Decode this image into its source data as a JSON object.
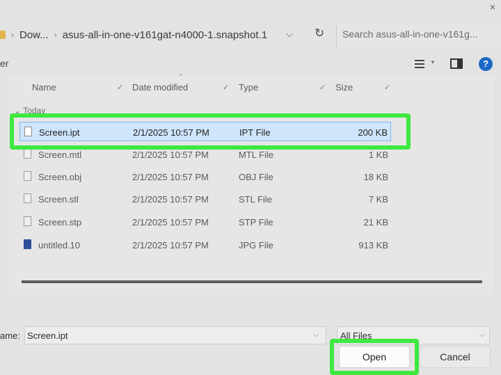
{
  "window": {
    "close_glyph": "×"
  },
  "address": {
    "crumbs": [
      "Dow...",
      "asus-all-in-one-v161gat-n4000-1.snapshot.1"
    ],
    "separator": "›",
    "dropdown_glyph": "⌵",
    "refresh_glyph": "↻"
  },
  "search": {
    "placeholder": "Search asus-all-in-one-v161g..."
  },
  "toolbar": {
    "left_label": "er",
    "help_glyph": "?"
  },
  "columns": {
    "name": "Name",
    "date": "Date modified",
    "type": "Type",
    "size": "Size",
    "chevron": "✓",
    "sort_caret": "⌃"
  },
  "group": {
    "label": "⌄ Today"
  },
  "files": [
    {
      "name": "Screen.ipt",
      "date": "2/1/2025 10:57 PM",
      "type": "IPT File",
      "size": "200 KB",
      "selected": true,
      "icon": "document-icon"
    },
    {
      "name": "Screen.mtl",
      "date": "2/1/2025 10:57 PM",
      "type": "MTL File",
      "size": "1 KB",
      "icon": "document-icon"
    },
    {
      "name": "Screen.obj",
      "date": "2/1/2025 10:57 PM",
      "type": "OBJ File",
      "size": "18 KB",
      "icon": "document-icon"
    },
    {
      "name": "Screen.stl",
      "date": "2/1/2025 10:57 PM",
      "type": "STL File",
      "size": "7 KB",
      "icon": "document-icon"
    },
    {
      "name": "Screen.stp",
      "date": "2/1/2025 10:57 PM",
      "type": "STP File",
      "size": "21 KB",
      "icon": "document-icon"
    },
    {
      "name": "untitled.10",
      "date": "2/1/2025 10:57 PM",
      "type": "JPG File",
      "size": "913 KB",
      "icon": "image-icon"
    }
  ],
  "bottom": {
    "filename_label": "ame:",
    "filename_value": "Screen.ipt",
    "filter_value": "All Files",
    "dropdown_glyph": "⌵",
    "open_label": "Open",
    "cancel_label": "Cancel"
  },
  "colors": {
    "highlight": "#3fe83f",
    "selection": "#cfe5fb",
    "help": "#1d6ac6"
  }
}
